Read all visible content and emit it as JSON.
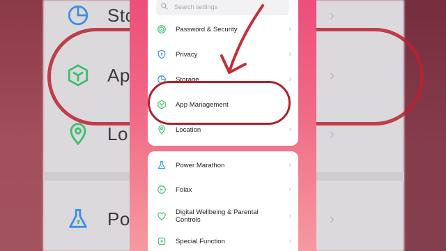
{
  "search": {
    "placeholder": "Search settings"
  },
  "top_items": [
    {
      "label": "Password & Security",
      "icon": "fingerprint-icon"
    },
    {
      "label": "Privacy",
      "icon": "shield-icon"
    },
    {
      "label": "Storage",
      "icon": "pie-chart-icon"
    },
    {
      "label": "App Management",
      "icon": "cube-icon"
    },
    {
      "label": "Location",
      "icon": "location-pin-icon"
    }
  ],
  "bottom_items": [
    {
      "label": "Power Marathon",
      "icon": "flask-icon"
    },
    {
      "label": "Folax",
      "icon": "folax-icon"
    },
    {
      "label": "Digital Wellbeing & Parental Controls",
      "icon": "wellbeing-icon"
    },
    {
      "label": "Special Function",
      "icon": "special-function-icon"
    }
  ],
  "background": {
    "labels": [
      "Sto",
      "App",
      "Lo",
      "Pow"
    ]
  },
  "colors": {
    "accent_green": "#3dbf6a",
    "accent_blue": "#3b8fe8",
    "annotation_red": "#b0202c",
    "phone_gradient_top": "#ee4e7a"
  }
}
